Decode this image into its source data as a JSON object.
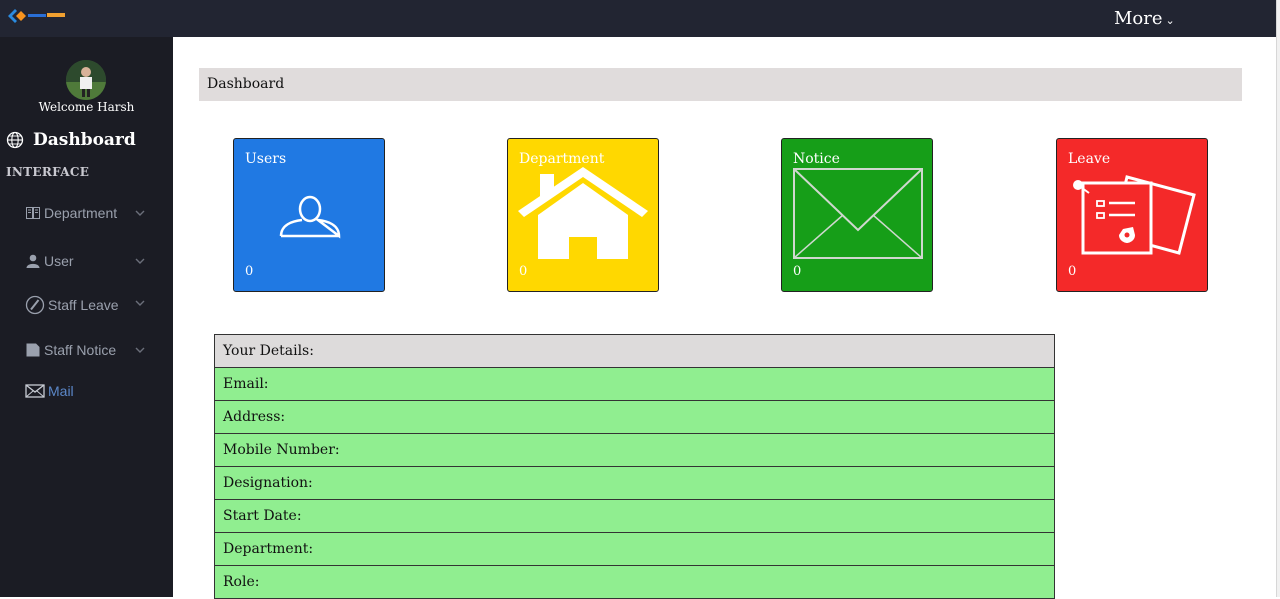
{
  "header": {
    "more_label": "More"
  },
  "colors": {
    "topbar": "#222532",
    "sidebar": "#1b1c24",
    "users_card": "#2079e3",
    "department_card": "#ffd800",
    "notice_card": "#169e18",
    "leave_card": "#f42929",
    "details_row": "#90ee90",
    "details_head": "#dddbdb"
  },
  "sidebar": {
    "welcome": "Welcome Harsh",
    "dashboard_label": "Dashboard",
    "section_label": "INTERFACE",
    "items": [
      {
        "label": "Department",
        "icon": "book-icon"
      },
      {
        "label": "User",
        "icon": "user-icon"
      },
      {
        "label": "Staff Leave",
        "icon": "edit-icon"
      },
      {
        "label": "Staff Notice",
        "icon": "file-icon"
      },
      {
        "label": "Mail",
        "icon": "envelope-icon"
      }
    ]
  },
  "breadcrumb": {
    "title": "Dashboard"
  },
  "cards": [
    {
      "title": "Users",
      "count": "0",
      "icon": "user-outline-icon"
    },
    {
      "title": "Department",
      "count": "0",
      "icon": "house-icon"
    },
    {
      "title": "Notice",
      "count": "0",
      "icon": "envelope-icon"
    },
    {
      "title": "Leave",
      "count": "0",
      "icon": "documents-icon"
    }
  ],
  "details": {
    "header": "Your Details:",
    "rows": [
      "Email:",
      "Address:",
      "Mobile Number:",
      "Designation:",
      "Start Date:",
      "Department:",
      "Role:"
    ]
  }
}
